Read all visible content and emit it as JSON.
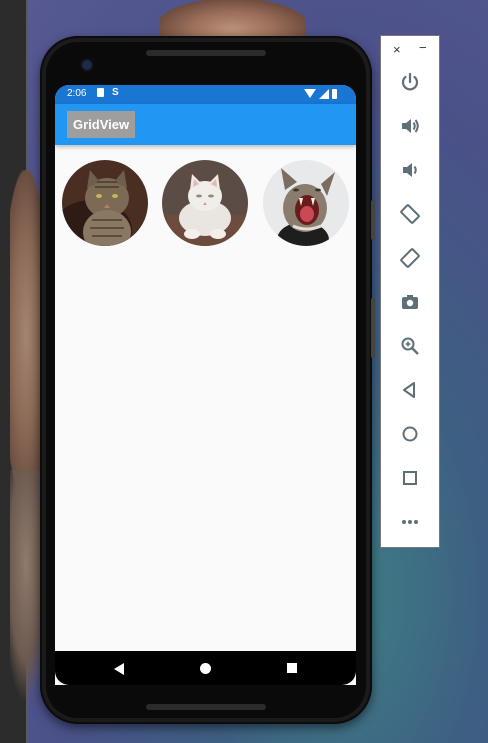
{
  "statusbar": {
    "time": "2:06",
    "s_icon": "S"
  },
  "appbar": {
    "title": "GridView"
  },
  "grid": {
    "items": [
      {
        "name": "cat-tabby",
        "icon": "cat-image"
      },
      {
        "name": "cat-white",
        "icon": "cat-image"
      },
      {
        "name": "cat-yawning",
        "icon": "cat-image"
      }
    ]
  },
  "navbar": {
    "buttons": [
      "back-icon",
      "home-icon",
      "recents-icon"
    ]
  },
  "emulator": {
    "close_label": "×",
    "minimize_label": "−",
    "tools": [
      "power-icon",
      "volume-up-icon",
      "volume-down-icon",
      "rotate-left-icon",
      "rotate-right-icon",
      "camera-icon",
      "zoom-icon",
      "back-icon",
      "home-icon",
      "overview-icon",
      "more-icon"
    ]
  },
  "colors": {
    "accent": "#2196f3",
    "statusbar": "#1976d2",
    "title_bg": "#9e9e9e"
  }
}
